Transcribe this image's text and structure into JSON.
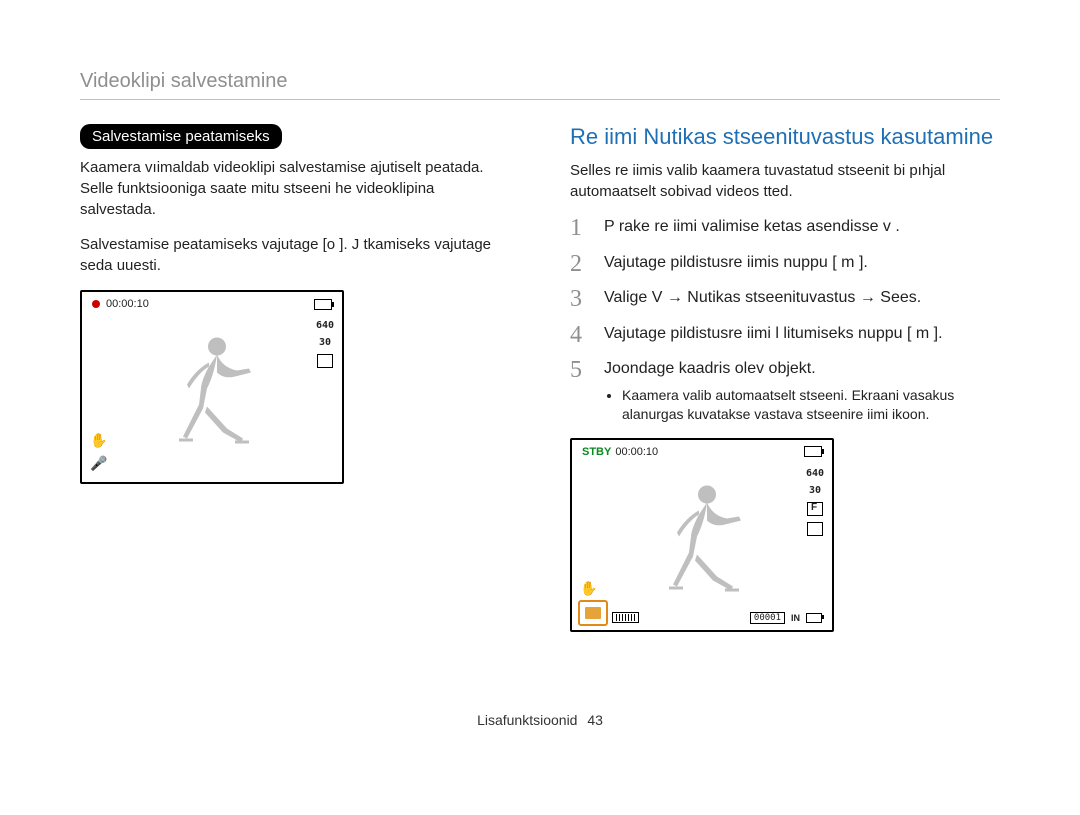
{
  "page_header": "Videoklipi salvestamine",
  "left": {
    "pill": "Salvestamise peatamiseks",
    "p1": "Kaamera vıimaldab videoklipi salvestamise ajutiselt peatada. Selle funktsiooniga saate mitu stseeni  he videoklipina salvestada.",
    "p2": "Salvestamise peatamiseks vajutage [o ]. J tkamiseks vajutage seda uuesti.",
    "screen": {
      "time": "00:00:10",
      "res": "640",
      "fps": "30"
    }
  },
  "right": {
    "heading": "Re iimi Nutikas stseenituvastus kasutamine",
    "intro": "Selles re iimis valib kaamera tuvastatud stseenit  bi pıhjal automaatselt sobivad videos tted.",
    "steps": {
      "s1": "P  rake re iimi valimise ketas asendisse    v     .",
      "s2": "Vajutage pildistusre iimis nuppu [ m         ].",
      "s3": "Valige V     → Nutikas stseenituvastus → Sees.",
      "s4": "Vajutage pildistusre iimi l litumiseks nuppu [  m         ].",
      "s5": "Joondage kaadris olev objekt.",
      "s5_sub": "Kaamera valib automaatselt stseeni. Ekraani vasakus alanurgas kuvatakse vastava stseenire iimi ikoon."
    },
    "screen": {
      "stby": "STBY",
      "time": "00:00:10",
      "res": "640",
      "fps": "30",
      "counter": "00001",
      "in": "IN"
    }
  },
  "footer": {
    "label": "Lisafunktsioonid",
    "page": "43"
  }
}
